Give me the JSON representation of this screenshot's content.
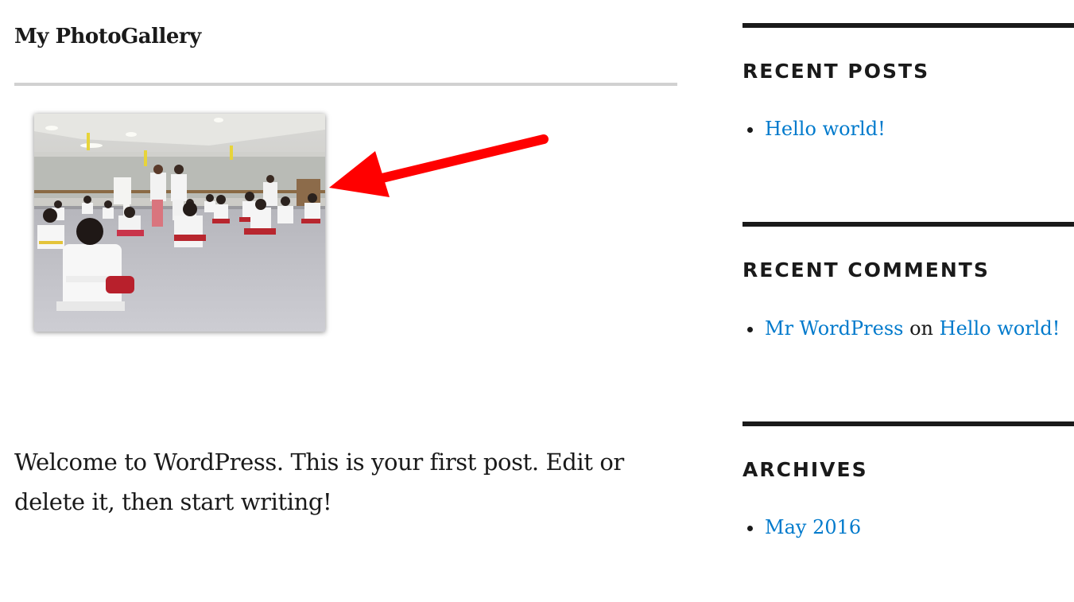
{
  "gallery": {
    "title": "My PhotoGallery",
    "image_name": "karate-class-photo"
  },
  "post": {
    "content": "Welcome to WordPress. This is your first post. Edit or delete it, then start writing!"
  },
  "annotation": {
    "color": "#ff0000",
    "shape": "arrow-pointing-left"
  },
  "sidebar": {
    "recent_posts": {
      "title": "RECENT POSTS",
      "items": [
        {
          "label": "Hello world!"
        }
      ]
    },
    "recent_comments": {
      "title": "RECENT COMMENTS",
      "items": [
        {
          "author": "Mr WordPress",
          "connector": "on",
          "post": "Hello world!"
        }
      ]
    },
    "archives": {
      "title": "ARCHIVES",
      "items": [
        {
          "label": "May 2016"
        }
      ]
    }
  },
  "colors": {
    "link": "#007acc",
    "text": "#1a1a1a",
    "rule": "#1a1a1a",
    "title_rule": "#d1d1d1"
  }
}
